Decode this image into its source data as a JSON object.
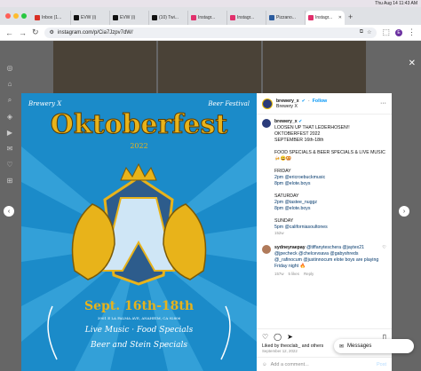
{
  "menubar": {
    "datetime": "Thu Aug 14  11:43 AM"
  },
  "tabs": [
    {
      "label": "Inbox (1...",
      "color": "#d93025",
      "active": false
    },
    {
      "label": "EVW (i)",
      "color": "#111111",
      "active": false
    },
    {
      "label": "EVW (i)",
      "color": "#111111",
      "active": false
    },
    {
      "label": "(10) Twi...",
      "color": "#111111",
      "active": false
    },
    {
      "label": "Instagr...",
      "color": "#e1306c",
      "active": false
    },
    {
      "label": "Instagr...",
      "color": "#e1306c",
      "active": false
    },
    {
      "label": "Pizzano...",
      "color": "#2b5c9e",
      "active": false
    },
    {
      "label": "Instagr...",
      "color": "#e1306c",
      "active": true
    }
  ],
  "address": {
    "url": "instagram.com/p/Cia7Jzpv7dW/",
    "profile_initial": "E"
  },
  "poster": {
    "top_left": "Brewery X",
    "top_right": "Beer Festival",
    "title": "Oktoberfest",
    "year": "2022",
    "dates": "Sept. 16th-18th",
    "address": "3901 E LA PALMA AVE, ANAHEIM, CA 92806",
    "line1": "Live Music · Food Specials",
    "line2": "Beer and Stein Specials",
    "center_letter": "X"
  },
  "post": {
    "username": "brewery_x",
    "follow": "Follow",
    "location": "Brewery X",
    "caption_user": "brewery_x",
    "caption_lines": [
      "LOOSEN UP THAT LEDERHOSEN!!",
      "OKTOBERFEST 2022",
      "SEPTEMBER 16th-18th",
      "",
      "FOOD SPECIALS & BEER SPECIALS & LIVE MUSIC 🍻😀🥨",
      "",
      "FRIDAY",
      "2pm @ericroebuckmusic",
      "8pm @elote.boys",
      "",
      "SATURDAY",
      "2pm @tastee_nuggz",
      "8pm @elote.boys",
      "",
      "SUNDAY",
      "5pm @californiasoultones"
    ],
    "caption_time": "152w",
    "comment": {
      "user": "sydneyraepay",
      "text": "@tiffanyteschera @jaytex21 @jpecheck @chelcevsava @gabyshreds @_rafinocum @justinnocum elote boys are playing Friday night 🔥",
      "time": "157w",
      "likes": "5 likes",
      "reply": "Reply"
    },
    "liked_by": "Liked by theoclab_ and others",
    "date": "September 12, 2022",
    "add_comment": "Add a comment...",
    "post_button": "Post"
  },
  "messages": {
    "label": "Messages"
  },
  "colors": {
    "poster_bg": "#1b8bc9",
    "gold": "#e8b31a",
    "overlay": "#000000"
  }
}
